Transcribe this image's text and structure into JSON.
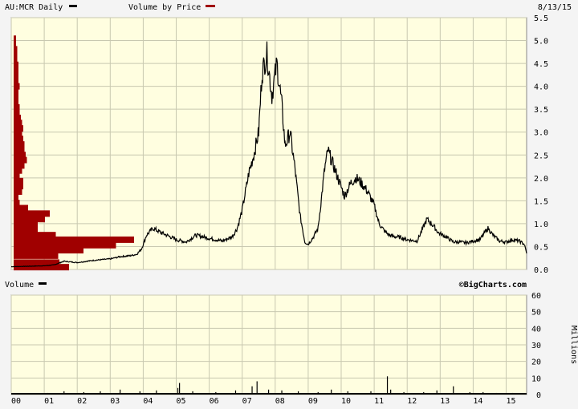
{
  "header": {
    "symbol_label": "AU:MCR Daily",
    "vbp_label": "Volume by Price",
    "date": "8/13/15"
  },
  "volume_header": {
    "label": "Volume",
    "credit": "©BigCharts.com"
  },
  "colors": {
    "panel_bg": "#fffee0",
    "page_bg": "#f4f4f4",
    "grid": "#c8c8b0",
    "price_line": "#000000",
    "vbp_bar": "#a00000",
    "volume_bar": "#000000"
  },
  "chart_data": [
    {
      "type": "line",
      "name": "price",
      "title": "AU:MCR Daily",
      "x_tick_labels": [
        "00",
        "01",
        "02",
        "03",
        "04",
        "05",
        "06",
        "07",
        "08",
        "09",
        "10",
        "11",
        "12",
        "13",
        "14",
        "15"
      ],
      "y_tick_labels": [
        "0.0",
        "0.5",
        "1.0",
        "1.5",
        "2.0",
        "2.5",
        "3.0",
        "3.5",
        "4.0",
        "4.5",
        "5.0",
        "5.5"
      ],
      "ylim": [
        0,
        5.5
      ],
      "xlim": [
        2000.0,
        2015.62
      ],
      "grid": true,
      "series": [
        {
          "name": "AU:MCR Daily",
          "x": [
            2000.0,
            2000.5,
            2001.0,
            2001.3,
            2001.6,
            2002.0,
            2002.5,
            2003.0,
            2003.3,
            2003.6,
            2003.8,
            2003.95,
            2004.1,
            2004.3,
            2004.55,
            2004.8,
            2005.0,
            2005.3,
            2005.6,
            2006.0,
            2006.4,
            2006.7,
            2006.85,
            2007.0,
            2007.2,
            2007.35,
            2007.5,
            2007.6,
            2007.75,
            2007.9,
            2008.05,
            2008.2,
            2008.3,
            2008.45,
            2008.6,
            2008.75,
            2008.9,
            2009.0,
            2009.15,
            2009.3,
            2009.5,
            2009.6,
            2009.75,
            2009.9,
            2010.1,
            2010.3,
            2010.45,
            2010.6,
            2010.8,
            2011.0,
            2011.15,
            2011.3,
            2011.45,
            2011.6,
            2011.8,
            2012.0,
            2012.3,
            2012.6,
            2012.8,
            2012.95,
            2013.2,
            2013.4,
            2013.6,
            2013.8,
            2014.0,
            2014.2,
            2014.45,
            2014.6,
            2014.8,
            2015.0,
            2015.2,
            2015.4,
            2015.55,
            2015.62
          ],
          "values": [
            0.06,
            0.07,
            0.08,
            0.1,
            0.18,
            0.15,
            0.2,
            0.23,
            0.28,
            0.3,
            0.33,
            0.45,
            0.75,
            0.9,
            0.8,
            0.72,
            0.65,
            0.6,
            0.75,
            0.68,
            0.62,
            0.72,
            0.9,
            1.3,
            2.1,
            2.5,
            3.0,
            4.3,
            4.7,
            3.8,
            4.5,
            3.6,
            2.7,
            3.0,
            2.2,
            1.2,
            0.6,
            0.55,
            0.7,
            0.9,
            2.2,
            2.6,
            2.3,
            2.0,
            1.6,
            1.9,
            2.0,
            1.9,
            1.7,
            1.4,
            1.0,
            0.85,
            0.75,
            0.72,
            0.7,
            0.65,
            0.62,
            1.1,
            0.95,
            0.8,
            0.7,
            0.6,
            0.6,
            0.58,
            0.62,
            0.65,
            0.9,
            0.75,
            0.62,
            0.6,
            0.65,
            0.62,
            0.55,
            0.35
          ]
        }
      ]
    },
    {
      "type": "bar",
      "name": "volume_by_price",
      "title": "Volume by Price",
      "orientation": "horizontal",
      "price_levels": [
        0.05,
        0.15,
        0.3,
        0.42,
        0.53,
        0.65,
        0.75,
        0.87,
        0.99,
        1.1,
        1.22,
        1.34,
        1.45,
        1.57,
        1.7,
        1.82,
        1.93,
        2.05,
        2.16,
        2.27,
        2.39,
        2.5,
        2.62,
        2.73,
        2.85,
        2.97,
        3.08,
        3.2,
        3.31,
        3.43,
        3.54,
        3.66,
        3.77,
        3.89,
        4.0,
        4.12,
        4.23,
        4.35,
        4.47,
        4.58,
        4.7,
        4.81,
        4.93,
        5.04
      ],
      "relative_volume": [
        0.46,
        0.38,
        0.37,
        0.58,
        0.85,
        1.0,
        0.35,
        0.2,
        0.2,
        0.26,
        0.3,
        0.12,
        0.05,
        0.04,
        0.07,
        0.08,
        0.08,
        0.05,
        0.07,
        0.09,
        0.11,
        0.1,
        0.09,
        0.09,
        0.08,
        0.07,
        0.08,
        0.07,
        0.06,
        0.05,
        0.05,
        0.04,
        0.04,
        0.04,
        0.05,
        0.04,
        0.04,
        0.04,
        0.04,
        0.03,
        0.03,
        0.03,
        0.02,
        0.02
      ]
    },
    {
      "type": "bar",
      "name": "volume",
      "title": "Volume",
      "ylabel": "Millions",
      "y_tick_labels": [
        "0",
        "10",
        "20",
        "30",
        "40",
        "50",
        "60"
      ],
      "ylim": [
        0,
        60
      ],
      "grid": true,
      "spikes": [
        {
          "x": 2000.3,
          "value": 0.6
        },
        {
          "x": 2001.1,
          "value": 1.0
        },
        {
          "x": 2001.6,
          "value": 2.0
        },
        {
          "x": 2002.2,
          "value": 1.5
        },
        {
          "x": 2002.7,
          "value": 2.0
        },
        {
          "x": 2003.3,
          "value": 3.0
        },
        {
          "x": 2003.9,
          "value": 2.0
        },
        {
          "x": 2004.4,
          "value": 2.5
        },
        {
          "x": 2005.05,
          "value": 4.0
        },
        {
          "x": 2005.1,
          "value": 7.0
        },
        {
          "x": 2005.5,
          "value": 2.0
        },
        {
          "x": 2006.2,
          "value": 1.5
        },
        {
          "x": 2006.8,
          "value": 2.5
        },
        {
          "x": 2007.3,
          "value": 5.0
        },
        {
          "x": 2007.45,
          "value": 8.0
        },
        {
          "x": 2007.8,
          "value": 3.0
        },
        {
          "x": 2008.2,
          "value": 2.5
        },
        {
          "x": 2008.7,
          "value": 2.0
        },
        {
          "x": 2009.3,
          "value": 1.5
        },
        {
          "x": 2009.7,
          "value": 3.0
        },
        {
          "x": 2010.2,
          "value": 2.0
        },
        {
          "x": 2010.9,
          "value": 2.0
        },
        {
          "x": 2011.4,
          "value": 11.0
        },
        {
          "x": 2011.5,
          "value": 3.0
        },
        {
          "x": 2011.9,
          "value": 1.5
        },
        {
          "x": 2012.5,
          "value": 1.5
        },
        {
          "x": 2012.9,
          "value": 2.5
        },
        {
          "x": 2013.4,
          "value": 5.0
        },
        {
          "x": 2013.9,
          "value": 1.5
        },
        {
          "x": 2014.3,
          "value": 1.5
        },
        {
          "x": 2014.7,
          "value": 1.0
        },
        {
          "x": 2015.2,
          "value": 1.0
        }
      ]
    }
  ]
}
